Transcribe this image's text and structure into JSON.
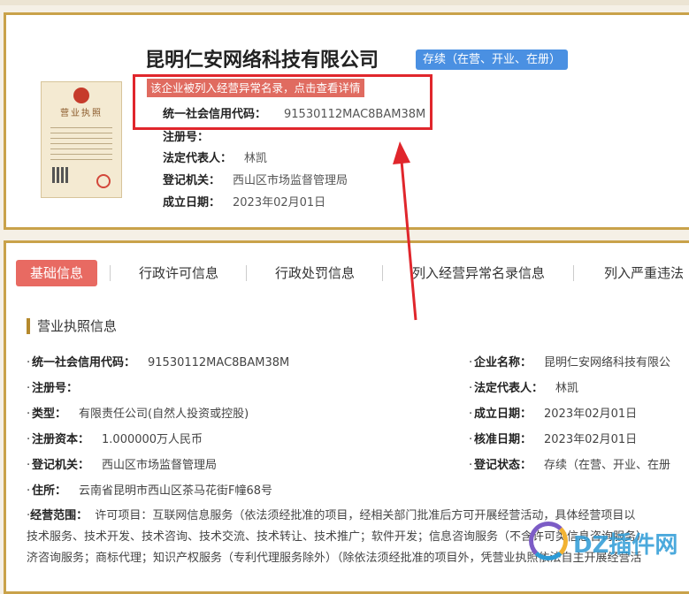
{
  "company": {
    "name": "昆明仁安网络科技有限公司",
    "status": "存续（在营、开业、在册）",
    "abnormal_notice": "该企业被列入经营异常名录，点击查看详情",
    "fields": [
      {
        "label": "统一社会信用代码：",
        "value": "91530112MAC8BAM38M"
      },
      {
        "label": "注册号：",
        "value": ""
      },
      {
        "label": "法定代表人：",
        "value": "林凯"
      },
      {
        "label": "登记机关：",
        "value": "西山区市场监督管理局"
      },
      {
        "label": "成立日期：",
        "value": "2023年02月01日"
      }
    ]
  },
  "tabs": [
    "基础信息",
    "行政许可信息",
    "行政处罚信息",
    "列入经营异常名录信息",
    "列入严重违法"
  ],
  "section": {
    "title": "营业执照信息",
    "left": [
      {
        "label": "统一社会信用代码：",
        "value": "91530112MAC8BAM38M"
      },
      {
        "label": "注册号：",
        "value": ""
      },
      {
        "label": "类型：",
        "value": "有限责任公司(自然人投资或控股)"
      },
      {
        "label": "注册资本：",
        "value": "1.000000万人民币"
      },
      {
        "label": "登记机关：",
        "value": "西山区市场监督管理局"
      },
      {
        "label": "住所：",
        "value": "云南省昆明市西山区茶马花街F幢68号"
      }
    ],
    "right": [
      {
        "label": "企业名称：",
        "value": "昆明仁安网络科技有限公"
      },
      {
        "label": "法定代表人：",
        "value": "林凯"
      },
      {
        "label": "成立日期：",
        "value": "2023年02月01日"
      },
      {
        "label": "核准日期：",
        "value": "2023年02月01日"
      },
      {
        "label": "登记状态：",
        "value": "存续（在营、开业、在册"
      }
    ],
    "scope_label": "经营范围：",
    "scope_lines": [
      "许可项目：互联网信息服务（依法须经批准的项目，经相关部门批准后方可开展经营活动，具体经营项目以",
      "技术服务、技术开发、技术咨询、技术交流、技术转让、技术推广；软件开发；信息咨询服务（不含许可类信息咨询服务）",
      "济咨询服务；商标代理；知识产权服务（专利代理服务除外）（除依法须经批准的项目外，凭营业执照依法自主开展经营活"
    ]
  },
  "license_title": "营业执照",
  "watermark": "DZ插件网",
  "colors": {
    "accent_gold": "#c9a24a",
    "tab_active": "#e86a62",
    "badge_blue": "#4a90e2",
    "highlight_red": "#e0262c"
  }
}
